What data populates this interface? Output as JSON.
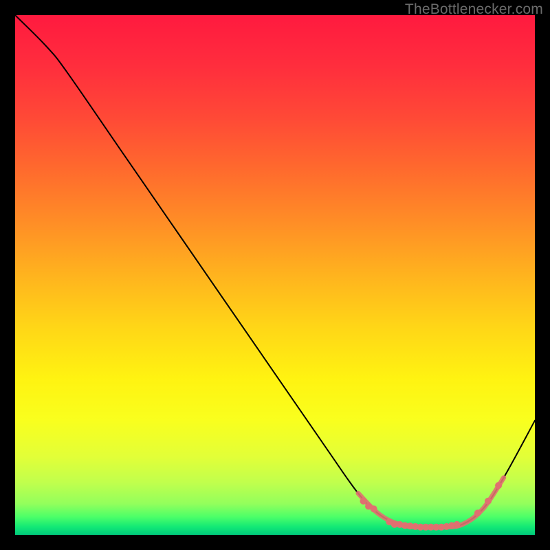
{
  "watermark": "TheBottlenecker.com",
  "chart_data": {
    "type": "line",
    "title": "",
    "xlabel": "",
    "ylabel": "",
    "xlim": [
      0,
      100
    ],
    "ylim": [
      0,
      100
    ],
    "grid": false,
    "series": [
      {
        "name": "curve",
        "points": [
          {
            "x": 0,
            "y": 100
          },
          {
            "x": 6,
            "y": 94
          },
          {
            "x": 10,
            "y": 89
          },
          {
            "x": 20,
            "y": 74.5
          },
          {
            "x": 30,
            "y": 60
          },
          {
            "x": 40,
            "y": 45.5
          },
          {
            "x": 50,
            "y": 31
          },
          {
            "x": 60,
            "y": 16.5
          },
          {
            "x": 66,
            "y": 8
          },
          {
            "x": 70,
            "y": 4
          },
          {
            "x": 74,
            "y": 2
          },
          {
            "x": 78,
            "y": 1.5
          },
          {
            "x": 82,
            "y": 1.5
          },
          {
            "x": 86,
            "y": 2
          },
          {
            "x": 90,
            "y": 5
          },
          {
            "x": 94,
            "y": 11
          },
          {
            "x": 100,
            "y": 22
          }
        ]
      },
      {
        "name": "scatter-markers",
        "type": "scatter",
        "color": "#e07070",
        "points": [
          {
            "x": 67,
            "y": 6.5
          },
          {
            "x": 68,
            "y": 5.5
          },
          {
            "x": 69,
            "y": 5.0
          },
          {
            "x": 72,
            "y": 2.5
          },
          {
            "x": 73,
            "y": 2.0
          },
          {
            "x": 74,
            "y": 2.0
          },
          {
            "x": 75,
            "y": 1.8
          },
          {
            "x": 76,
            "y": 1.7
          },
          {
            "x": 77,
            "y": 1.6
          },
          {
            "x": 78,
            "y": 1.5
          },
          {
            "x": 79,
            "y": 1.5
          },
          {
            "x": 80,
            "y": 1.5
          },
          {
            "x": 81,
            "y": 1.5
          },
          {
            "x": 82,
            "y": 1.5
          },
          {
            "x": 83,
            "y": 1.6
          },
          {
            "x": 84,
            "y": 1.8
          },
          {
            "x": 85,
            "y": 2.0
          },
          {
            "x": 89,
            "y": 4.2
          },
          {
            "x": 91,
            "y": 6.5
          },
          {
            "x": 93,
            "y": 9.5
          }
        ]
      }
    ],
    "gradient_stops": [
      {
        "offset": 0.0,
        "color": "#ff1a3f"
      },
      {
        "offset": 0.1,
        "color": "#ff2e3d"
      },
      {
        "offset": 0.2,
        "color": "#ff4a36"
      },
      {
        "offset": 0.3,
        "color": "#ff6b2d"
      },
      {
        "offset": 0.4,
        "color": "#ff8e26"
      },
      {
        "offset": 0.5,
        "color": "#ffb31e"
      },
      {
        "offset": 0.6,
        "color": "#ffd617"
      },
      {
        "offset": 0.7,
        "color": "#fff311"
      },
      {
        "offset": 0.78,
        "color": "#f9ff1e"
      },
      {
        "offset": 0.85,
        "color": "#e2ff38"
      },
      {
        "offset": 0.9,
        "color": "#c0ff4d"
      },
      {
        "offset": 0.94,
        "color": "#93ff5c"
      },
      {
        "offset": 0.965,
        "color": "#4dff68"
      },
      {
        "offset": 0.985,
        "color": "#12e876"
      },
      {
        "offset": 1.0,
        "color": "#00c97a"
      }
    ]
  }
}
